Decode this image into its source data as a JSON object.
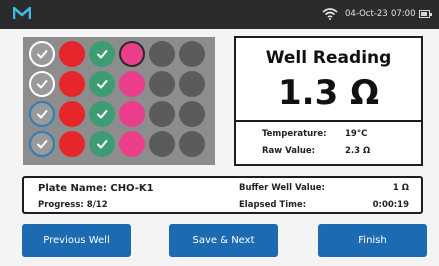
{
  "status_bar": {
    "date": "04-Oct-23",
    "time": "07:00",
    "icons": [
      "logo-icon",
      "wifi-icon",
      "battery-icon"
    ]
  },
  "plate": {
    "rows": [
      [
        "done-gray",
        "red",
        "green",
        "active",
        "empty",
        "empty"
      ],
      [
        "done-gray",
        "red",
        "green",
        "pink",
        "empty",
        "empty"
      ],
      [
        "done-blue",
        "red",
        "green",
        "pink",
        "empty",
        "empty"
      ],
      [
        "done-blue",
        "red",
        "green",
        "pink",
        "empty",
        "empty"
      ]
    ]
  },
  "reading": {
    "title": "Well Reading",
    "value": "1.3 Ω",
    "temperature_label": "Temperature:",
    "temperature_value": "19°C",
    "raw_label": "Raw Value:",
    "raw_value": "2.3 Ω"
  },
  "info": {
    "plate_name_label": "Plate Name: CHO-K1",
    "progress_label": "Progress: 8/12",
    "buffer_label": "Buffer Well Value:",
    "buffer_value": "1 Ω",
    "elapsed_label": "Elapsed Time:",
    "elapsed_value": "0:00:19"
  },
  "buttons": {
    "previous": "Previous Well",
    "save_next": "Save & Next",
    "finish": "Finish"
  },
  "colors": {
    "accent": "#1c6bb2",
    "red": "#e6262a",
    "green": "#3e9c74",
    "pink": "#ea3e8b"
  }
}
